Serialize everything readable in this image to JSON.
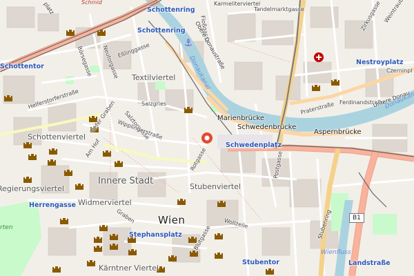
{
  "map": {
    "city_label": "Wien",
    "district_labels": {
      "innere_stadt": "Innere Stadt",
      "schottenviertel": "Schottenviertel",
      "textilviertel": "Textilviertel",
      "stubenviertel": "Stubenviertel",
      "widmerviertel": "Widmerviertel",
      "kaerntner": "Kärntner Viertel",
      "regierung": "Regierungsviertel"
    },
    "station_labels": {
      "schottenring_top": "Schottenring",
      "schottenring": "Schottenring",
      "schottentor": "Schottentor",
      "nestroyplatz": "Nestroyplatz",
      "schwedenplatz": "Schwedenplatz",
      "herrengasse": "Herrengasse",
      "stephansplatz": "Stephansplatz",
      "stubentor": "Stubentor",
      "landstrasse": "Landstraße"
    },
    "bridge_labels": {
      "marienbruecke": "Marienbrücke",
      "schwedenbruecke": "Schwedenbrücke",
      "aspernbruecke": "Aspernbrücke"
    },
    "street_labels": {
      "karmeliterviertel": "Karmeliterviertel",
      "tandelmarktgasse": "Tandelmarktgasse",
      "floßgasse": "Floßgasse",
      "obere_donaustrasse": "Obere Donaustraße",
      "zirkusgasse": "Zirkusgasse",
      "weintraubengasse": "Weintraubeng",
      "czerninplatz": "Czerninpl",
      "ferdinandstrasse": "Ferdinandstraße",
      "praterstrasse": "Praterstraße",
      "untere_donau": "Untere Donau",
      "helferstorferstrasse": "Helferstorferstraße",
      "boersegasse": "Börsegasse",
      "neutorgasse": "Neutorgasse",
      "eßlinggasse": "Eßlinggasse",
      "salzgries": "Salzgries",
      "sterngasse": "Sterngasse",
      "salztorgasse": "Salztorgasse",
      "wipplingerstrasse": "Wipplingerstraße",
      "tiefer_graben": "Tiefer Graben",
      "am_hof": "Am Hof",
      "rotgasse": "Rotgasse",
      "postgasse": "Postgasse",
      "wollzeile": "Wollzeile",
      "blutgasse": "Blutgasse",
      "graben": "Graben",
      "stubenring": "Stubenring",
      "schmid": "Schmid",
      "platz": "platz",
      "b1": "B1"
    },
    "water_labels": {
      "donaukanal_upper": "Donaukanal",
      "donaukanal_lower": "Donaukanal",
      "wienfluss": "Wienfluss"
    },
    "park_labels": {
      "garten": "rten"
    },
    "colors": {
      "background": "#f2efe9",
      "water": "#aad3df",
      "major_road": "#f9b29c",
      "secondary_road": "#fcd6a4",
      "primary_road": "#f7fabf",
      "tram_line": "#444444",
      "park": "#c8facc",
      "building": "#d9d0c9",
      "castle_icon": "#8a5a00",
      "marker": "#e24a33",
      "hospital": "#c40000"
    },
    "icons": [
      "castle-icon",
      "hospital-icon",
      "location-marker-icon",
      "anchor-icon"
    ]
  }
}
